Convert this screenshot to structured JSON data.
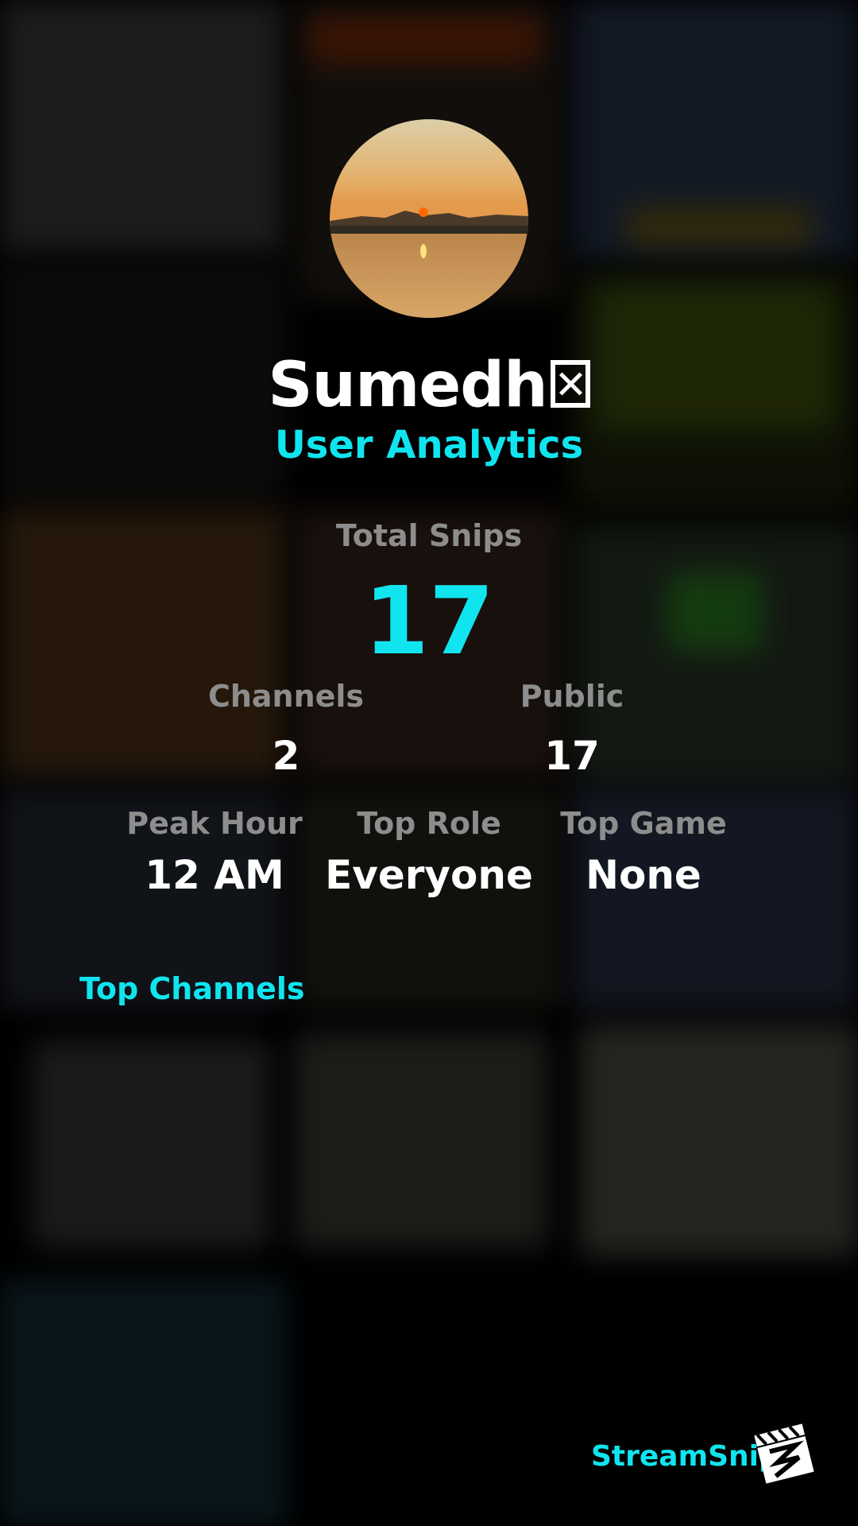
{
  "profile": {
    "username": "Sumedh",
    "subtitle": "User Analytics"
  },
  "stats": {
    "total_label": "Total Snips",
    "total_value": "17",
    "channels_label": "Channels",
    "channels_value": "2",
    "public_label": "Public",
    "public_value": "17",
    "peak_hour_label": "Peak Hour",
    "peak_hour_value": "12 AM",
    "top_role_label": "Top Role",
    "top_role_value": "Everyone",
    "top_game_label": "Top Game",
    "top_game_value": "None"
  },
  "sections": {
    "top_channels": "Top Channels"
  },
  "brand": {
    "name": "StreamSnip"
  },
  "colors": {
    "accent": "#10e5ef",
    "label": "#8d8d8d",
    "text": "#ffffff",
    "background": "#000000"
  }
}
